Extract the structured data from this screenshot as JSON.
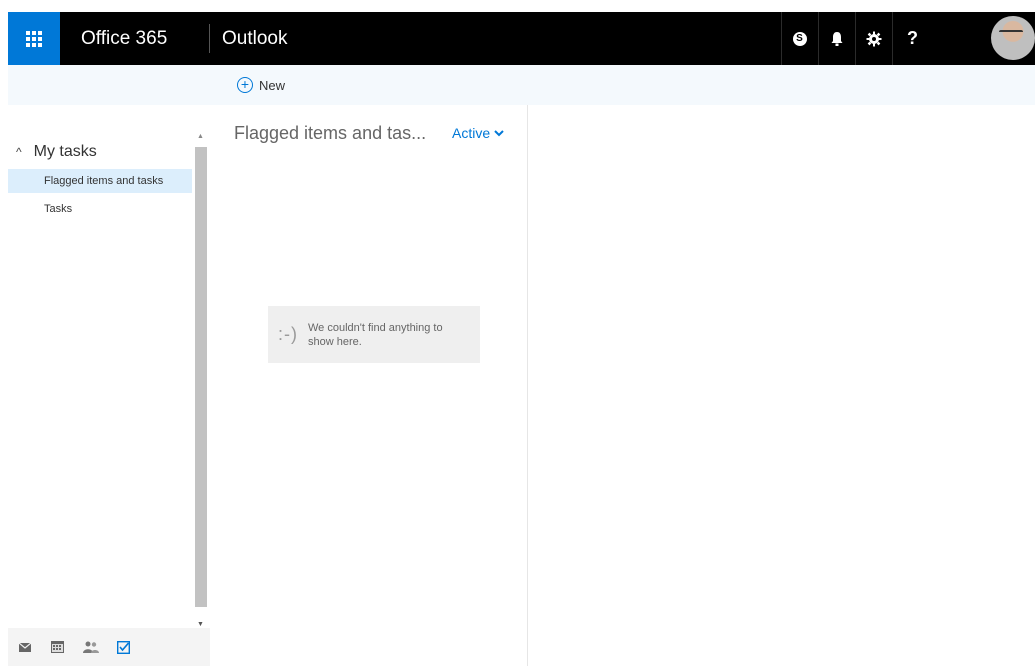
{
  "header": {
    "brand": "Office 365",
    "app": "Outlook",
    "icons": [
      "waffle-icon",
      "skype-icon",
      "bell-icon",
      "gear-icon",
      "help-icon"
    ],
    "help_label": "?",
    "skype_label": "S"
  },
  "command_bar": {
    "new_label": "New",
    "new_symbol": "+"
  },
  "nav": {
    "section_label": "My tasks",
    "items": [
      {
        "label": "Flagged items and tasks",
        "selected": true
      },
      {
        "label": "Tasks",
        "selected": false
      }
    ],
    "bottom_apps": [
      "mail-icon",
      "calendar-icon",
      "people-icon",
      "tasks-icon"
    ]
  },
  "list": {
    "title": "Flagged items and tas...",
    "filter_label": "Active",
    "empty_face": ":-)",
    "empty_message": "We couldn't find anything to show here."
  },
  "colors": {
    "accent": "#0078d7",
    "topbar": "#000000",
    "selected_bg": "#dceefc",
    "command_bar_bg": "#f4f9fd"
  }
}
